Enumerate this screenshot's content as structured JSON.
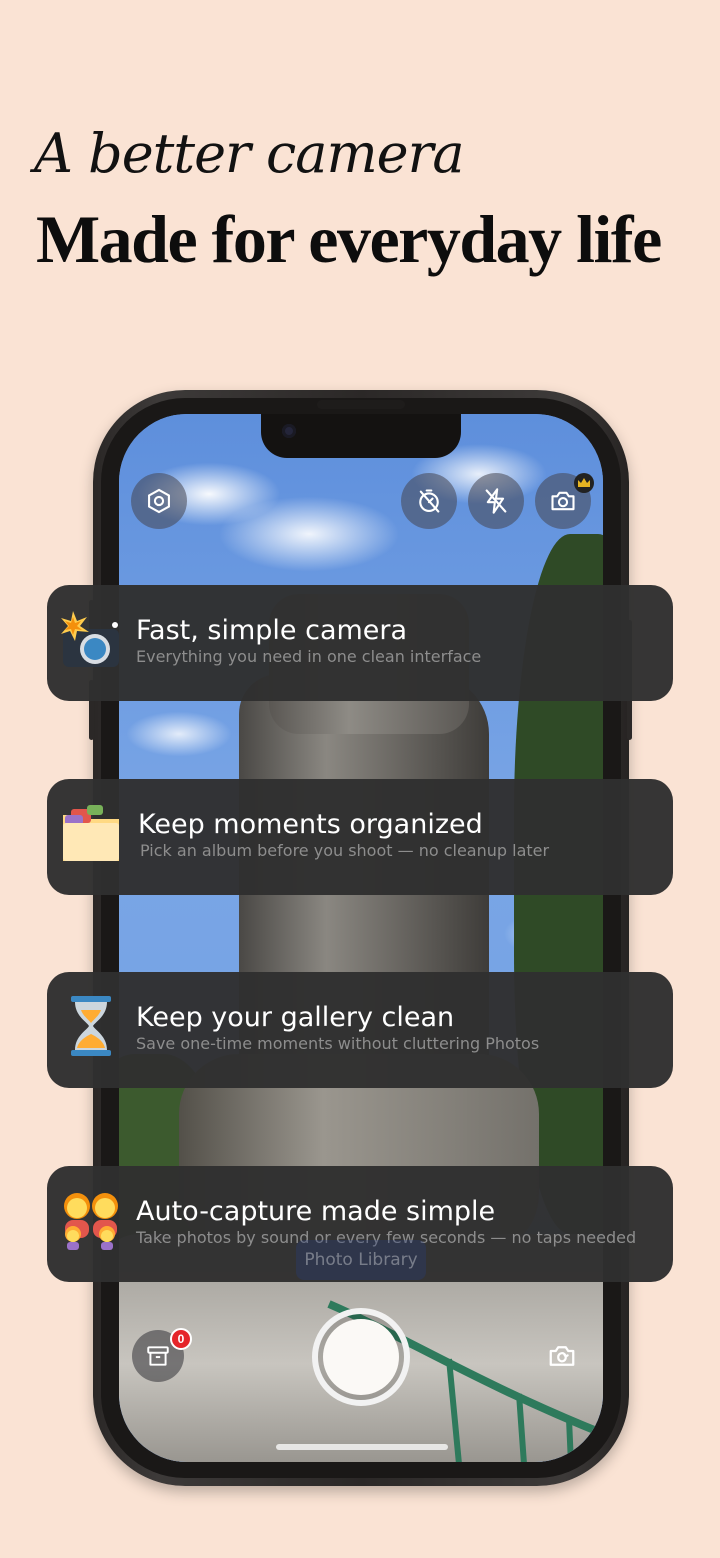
{
  "hero": {
    "tagline": "A better camera",
    "headline": "Made for everyday life"
  },
  "camera_top": {
    "settings_icon": "gear-hexagon-icon",
    "timer_icon": "timer-off-icon",
    "flash_icon": "flash-off-icon",
    "camera_icon": "camera-icon",
    "premium_icon": "crown-icon"
  },
  "features": [
    {
      "icon": "camera-flash-emoji",
      "title": "Fast, simple camera",
      "subtitle": "Everything you need in one clean interface"
    },
    {
      "icon": "folder-emoji",
      "title": "Keep moments organized",
      "subtitle": "Pick an album before you shoot — no cleanup later"
    },
    {
      "icon": "hourglass-emoji",
      "title": "Keep your gallery clean",
      "subtitle": "Save one-time moments without cluttering Photos"
    },
    {
      "icon": "people-emoji",
      "title": "Auto-capture made simple",
      "subtitle": "Take photos by sound or every few seconds — no taps needed"
    }
  ],
  "camera_bottom": {
    "photo_library_label": "Photo Library",
    "archive_badge": "0",
    "archive_icon": "archive-box-icon",
    "flip_icon": "flip-camera-icon",
    "shutter_icon": "shutter-button"
  },
  "colors": {
    "background": "#fae3d4",
    "card": "#303030",
    "badge": "#e5252a"
  }
}
